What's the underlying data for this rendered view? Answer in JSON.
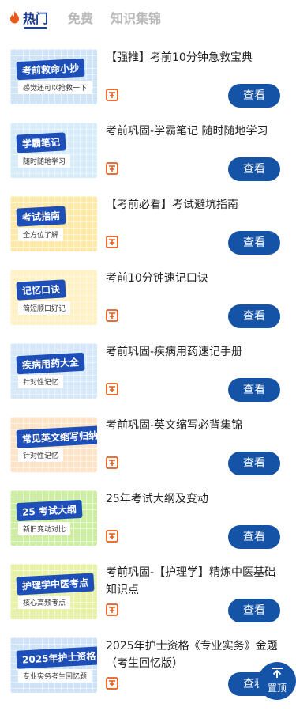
{
  "tabs": [
    {
      "label": "热门",
      "active": true
    },
    {
      "label": "免费",
      "active": false
    },
    {
      "label": "知识集锦",
      "active": false
    }
  ],
  "colors": {
    "accent": "#1553a6",
    "hot": "#e85a1a",
    "tab_active": "#1a3c8f"
  },
  "items": [
    {
      "title": "【强推】考前10分钟急救宝典",
      "button": "查看",
      "thumb_text": "考前救命小抄",
      "thumb_sub": "感觉还可以抢救一下",
      "thumb_bg": "#cfe4f6"
    },
    {
      "title": "考前巩固-学霸笔记 随时随地学习",
      "button": "查看",
      "thumb_text": "学霸笔记",
      "thumb_sub": "随时随地学习",
      "thumb_bg": "#d6ecfb"
    },
    {
      "title": "【考前必看】考试避坑指南",
      "button": "查看",
      "thumb_text": "考试指南",
      "thumb_sub": "全方位了解",
      "thumb_bg": "#ffe9a8"
    },
    {
      "title": "考前10分钟速记口诀",
      "button": "查看",
      "thumb_text": "记忆口诀",
      "thumb_sub": "简短顺口好记",
      "thumb_bg": "#fff1c4"
    },
    {
      "title": "考前巩固-疾病用药速记手册",
      "button": "查看",
      "thumb_text": "疾病用药大全",
      "thumb_sub": "针对性记忆",
      "thumb_bg": "#d5e9fa"
    },
    {
      "title": "考前巩固-英文缩写必背集锦",
      "button": "查看",
      "thumb_text": "常见英文缩写归纳",
      "thumb_sub": "针对性记忆",
      "thumb_bg": "#fde4c8"
    },
    {
      "title": "25年考试大纲及变动",
      "button": "查看",
      "thumb_text": "25 考试大纲",
      "thumb_sub": "新旧变动对比",
      "thumb_bg": "#cdeea0"
    },
    {
      "title": "考前巩固-【护理学】精炼中医基础知识点",
      "button": "查看",
      "thumb_text": "护理学中医考点",
      "thumb_sub": "核心高频考点",
      "thumb_bg": "#e7f2a6"
    },
    {
      "title": "2025年护士资格《专业实务》金题（考生回忆版）",
      "button": "查看",
      "thumb_text": "2025年护士资格",
      "thumb_sub": "专业实务考生回忆题",
      "thumb_bg": "#cfe3f8"
    }
  ],
  "back_to_top": {
    "label": "置顶"
  }
}
